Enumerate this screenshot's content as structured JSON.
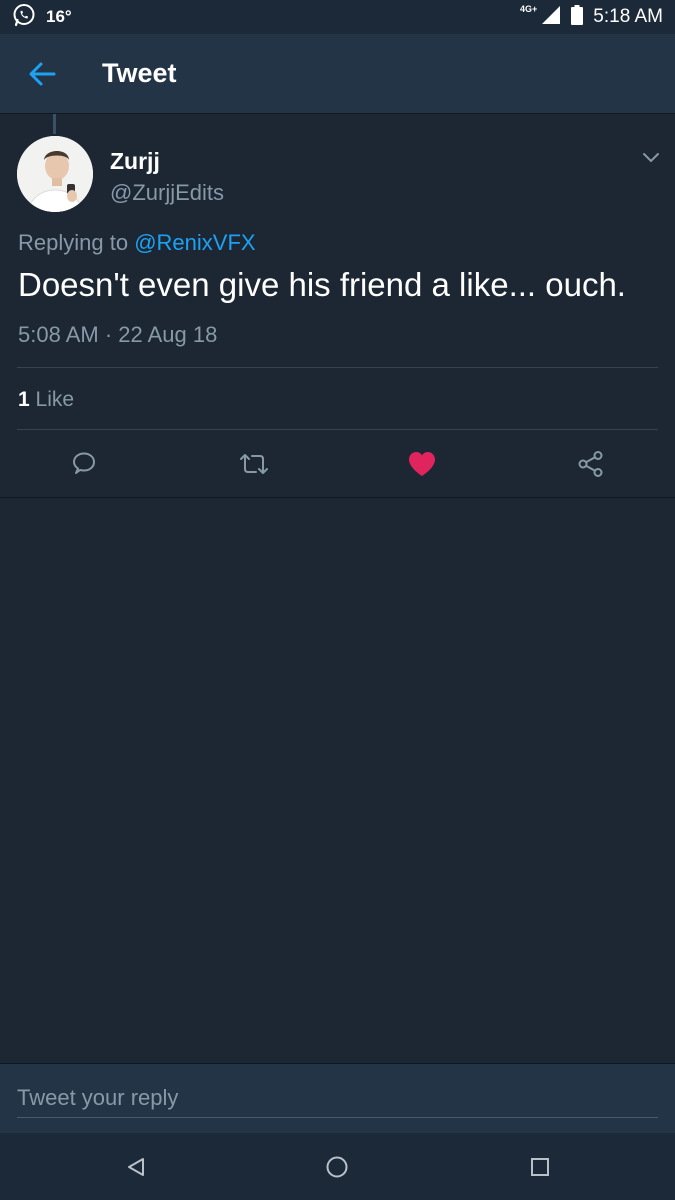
{
  "status_bar": {
    "temperature": "16°",
    "network": "4G+",
    "time": "5:18 AM",
    "icons": [
      "whatsapp-icon",
      "signal-icon",
      "battery-icon"
    ]
  },
  "app_bar": {
    "title": "Tweet",
    "back_icon": "arrow-left-icon"
  },
  "tweet": {
    "author_name": "Zurjj",
    "author_handle": "@ZurjjEdits",
    "replying_prefix": "Replying to ",
    "replying_to": "@RenixVFX",
    "text": "Doesn't even give his friend a like... ouch.",
    "timestamp": "5:08 AM · 22 Aug 18",
    "like_count": "1",
    "like_label": "Like",
    "actions": [
      "reply-icon",
      "retweet-icon",
      "like-icon",
      "share-icon"
    ]
  },
  "reply": {
    "placeholder": "Tweet your reply"
  },
  "nav": {
    "icons": [
      "back-triangle-icon",
      "home-circle-icon",
      "recents-square-icon"
    ]
  },
  "colors": {
    "background": "#1c2733",
    "bar": "#243447",
    "accent": "#1da1f2",
    "like": "#e0245e",
    "muted": "#8899a6"
  }
}
